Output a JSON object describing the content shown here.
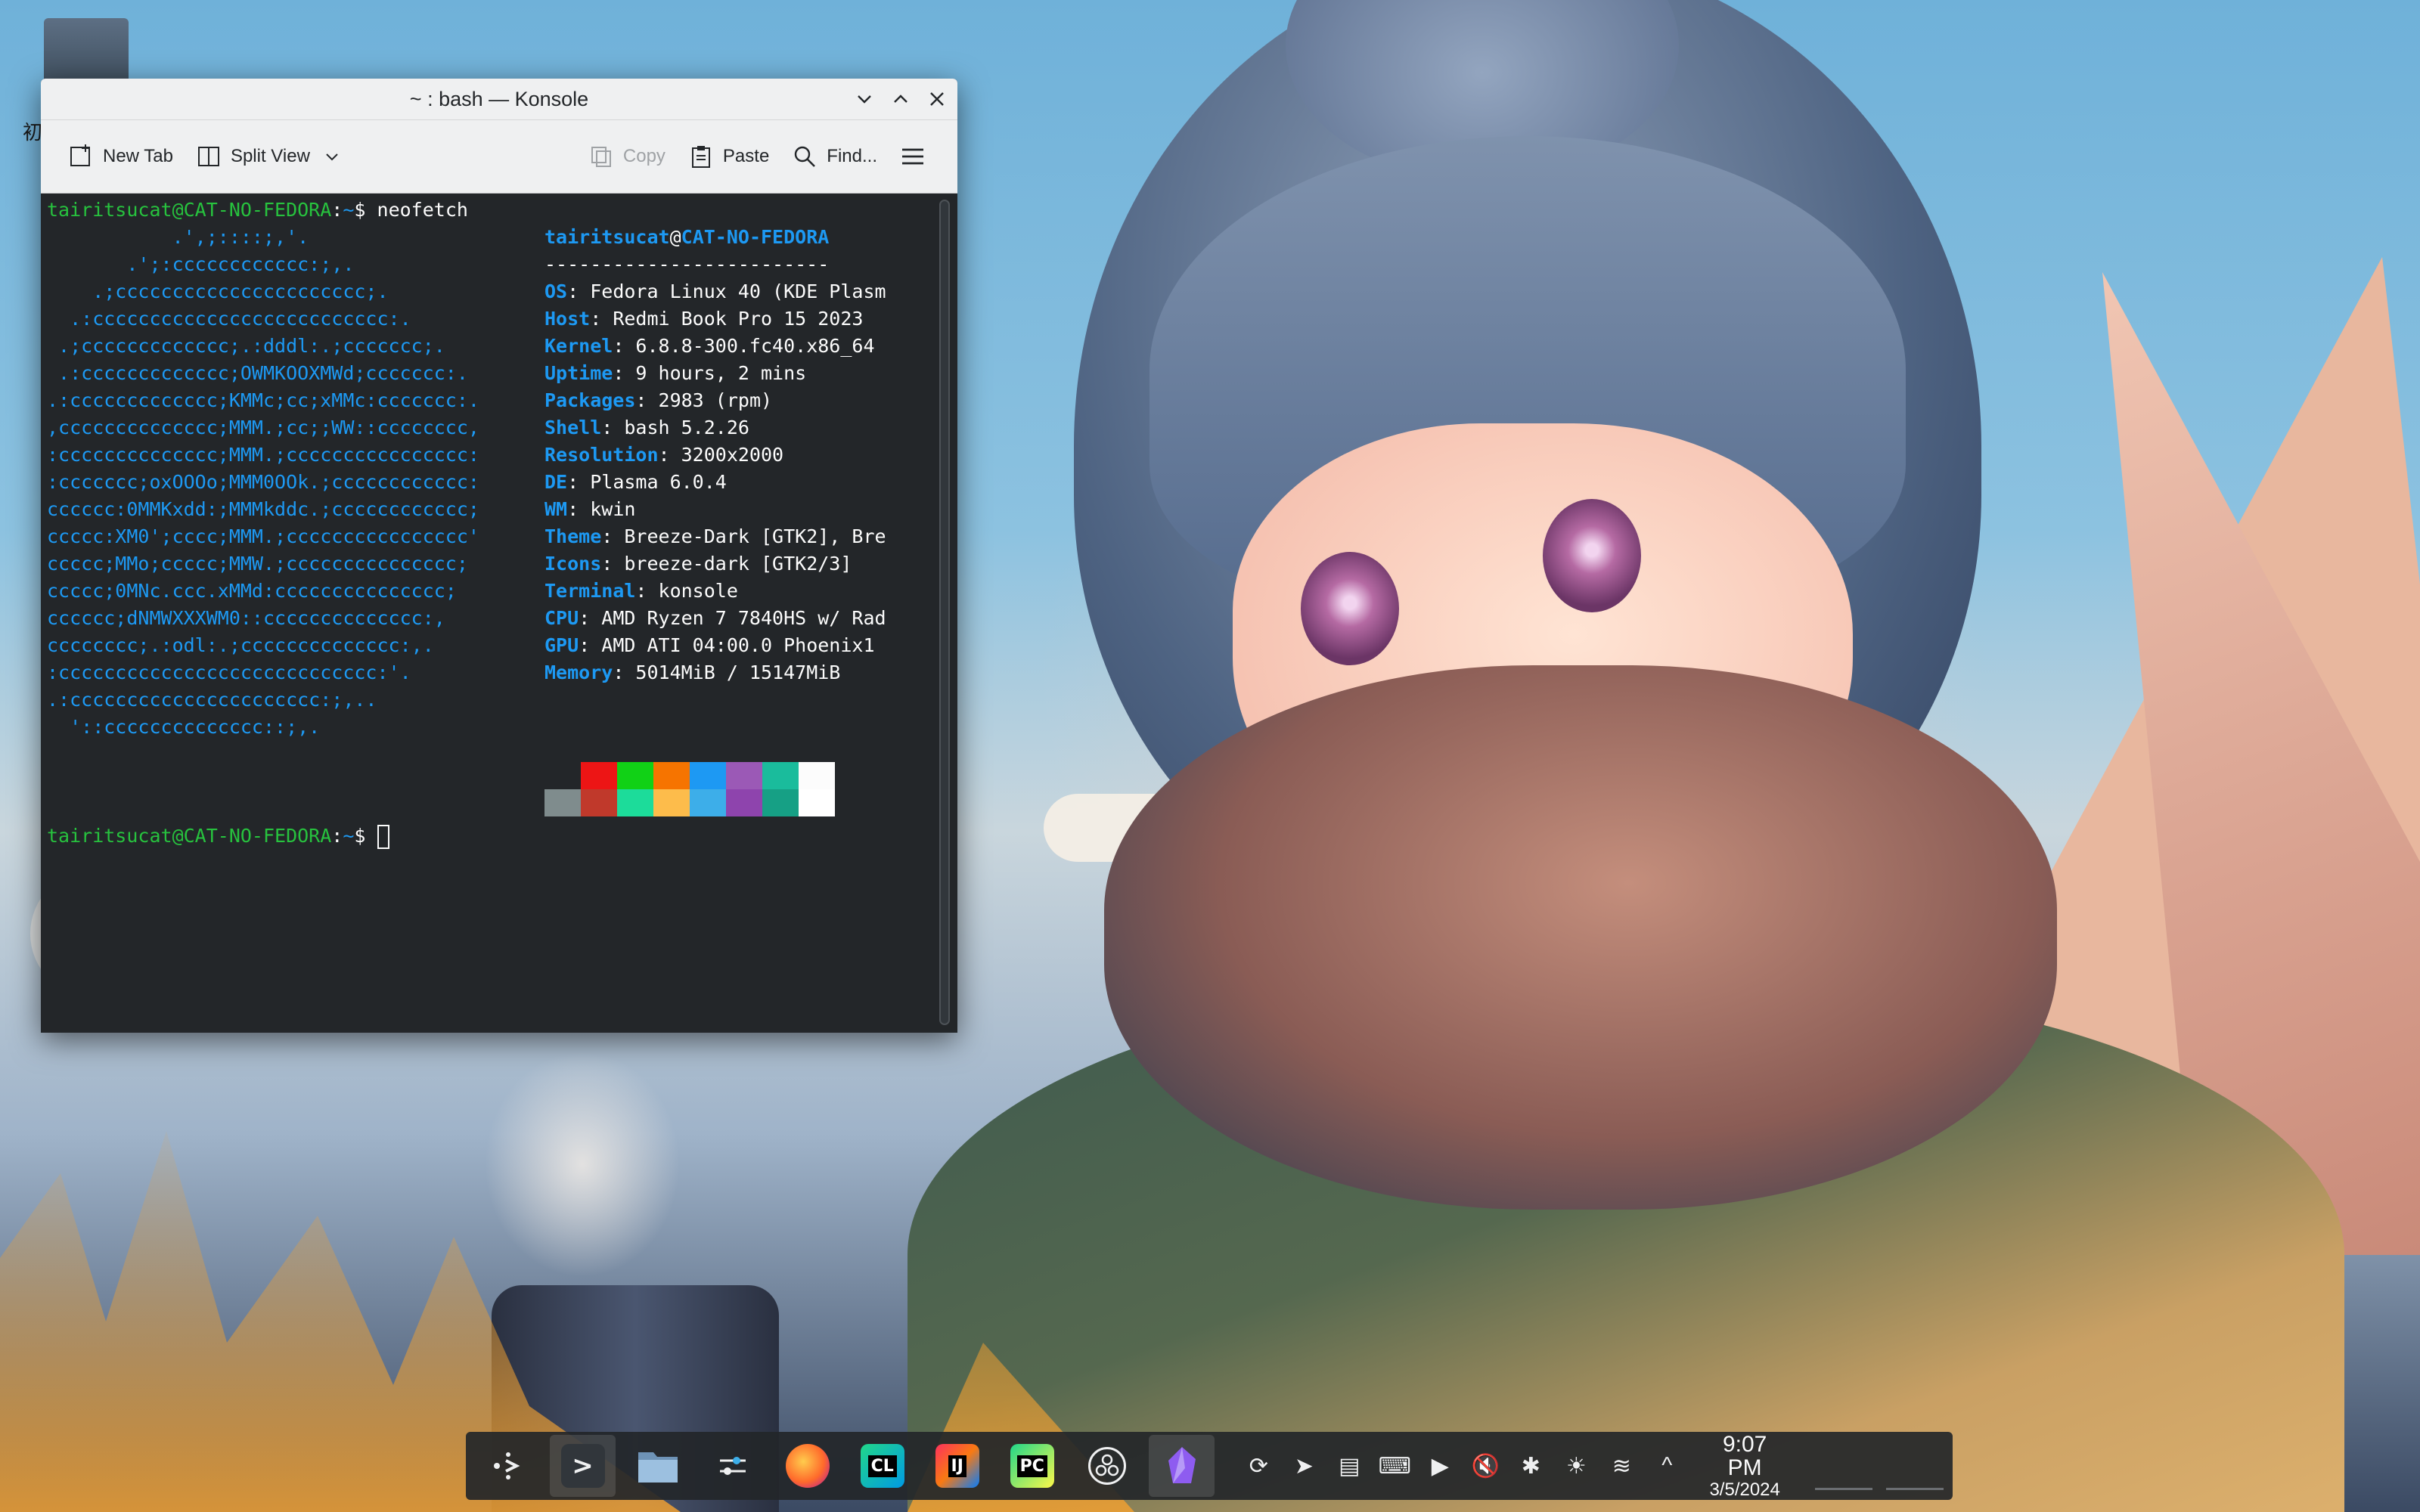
{
  "desktop": {
    "icon_label": "初"
  },
  "window": {
    "title": "~ : bash — Konsole",
    "controls": [
      "minimize",
      "maximize",
      "close"
    ]
  },
  "toolbar": {
    "new_tab": "New Tab",
    "split_view": "Split View",
    "copy": "Copy",
    "paste": "Paste",
    "find": "Find..."
  },
  "terminal": {
    "prompt_user": "tairitsucat@CAT-NO-FEDORA",
    "prompt_sep": ":",
    "prompt_dir": "~",
    "prompt_end": "$ ",
    "command": "neofetch",
    "logo_lines": [
      "           .',;::::;,'.",
      "       .';:cccccccccccc:;,.",
      "    .;cccccccccccccccccccccc;.",
      "  .:cccccccccccccccccccccccccc:.",
      " .;ccccccccccccc;.:dddl:.;ccccccc;.",
      " .:ccccccccccccc;OWMKOOXMWd;ccccccc:.",
      ".:ccccccccccccc;KMMc;cc;xMMc:ccccccc:.",
      ",cccccccccccccc;MMM.;cc;;WW::cccccccc,",
      ":cccccccccccccc;MMM.;cccccccccccccccc:",
      ":ccccccc;oxOOOo;MMM0OOk.;cccccccccccc:",
      "cccccc:0MMKxdd:;MMMkddc.;cccccccccccc;",
      "ccccc:XM0';cccc;MMM.;cccccccccccccccc'",
      "ccccc;MMo;ccccc;MMW.;ccccccccccccccc;",
      "ccccc;0MNc.ccc.xMMd:ccccccccccccccc;",
      "cccccc;dNMWXXXWM0::cccccccccccccc:,",
      "cccccccc;.:odl:.;cccccccccccccc:,.",
      ":cccccccccccccccccccccccccccc:'.",
      ".:cccccccccccccccccccccc:;,..",
      "  '::cccccccccccccc::;,."
    ],
    "info_header_user": "tairitsucat",
    "info_header_at": "@",
    "info_header_host": "CAT-NO-FEDORA",
    "info_separator": "-------------------------",
    "info": [
      {
        "key": "OS",
        "value": "Fedora Linux 40 (KDE Plasm"
      },
      {
        "key": "Host",
        "value": "Redmi Book Pro 15 2023"
      },
      {
        "key": "Kernel",
        "value": "6.8.8-300.fc40.x86_64"
      },
      {
        "key": "Uptime",
        "value": "9 hours, 2 mins"
      },
      {
        "key": "Packages",
        "value": "2983 (rpm)"
      },
      {
        "key": "Shell",
        "value": "bash 5.2.26"
      },
      {
        "key": "Resolution",
        "value": "3200x2000"
      },
      {
        "key": "DE",
        "value": "Plasma 6.0.4"
      },
      {
        "key": "WM",
        "value": "kwin"
      },
      {
        "key": "Theme",
        "value": "Breeze-Dark [GTK2], Bre"
      },
      {
        "key": "Icons",
        "value": "breeze-dark [GTK2/3]"
      },
      {
        "key": "Terminal",
        "value": "konsole"
      },
      {
        "key": "CPU",
        "value": "AMD Ryzen 7 7840HS w/ Rad"
      },
      {
        "key": "GPU",
        "value": "AMD ATI 04:00.0 Phoenix1"
      },
      {
        "key": "Memory",
        "value": "5014MiB / 15147MiB"
      }
    ],
    "palette_top": [
      "#232629",
      "#ed1515",
      "#11d116",
      "#f67400",
      "#1d99f3",
      "#9b59b6",
      "#1abc9c",
      "#fcfcfc"
    ],
    "palette_bottom": [
      "#7f8c8d",
      "#c0392b",
      "#1cdc9a",
      "#fdbc4b",
      "#3daee9",
      "#8e44ad",
      "#16a085",
      "#ffffff"
    ]
  },
  "taskbar": {
    "pins": [
      {
        "name": "kde-menu-icon",
        "label": ""
      },
      {
        "name": "konsole-icon",
        "label": ">"
      },
      {
        "name": "dolphin-icon",
        "label": ""
      },
      {
        "name": "system-settings-icon",
        "label": ""
      },
      {
        "name": "firefox-icon",
        "label": ""
      },
      {
        "name": "clion-icon",
        "label": "CL"
      },
      {
        "name": "intellij-icon",
        "label": "IJ"
      },
      {
        "name": "pycharm-icon",
        "label": "PC"
      },
      {
        "name": "obs-icon",
        "label": ""
      },
      {
        "name": "obsidian-icon",
        "label": ""
      }
    ],
    "clock_time": "9:07 PM",
    "clock_date": "3/5/2024"
  }
}
